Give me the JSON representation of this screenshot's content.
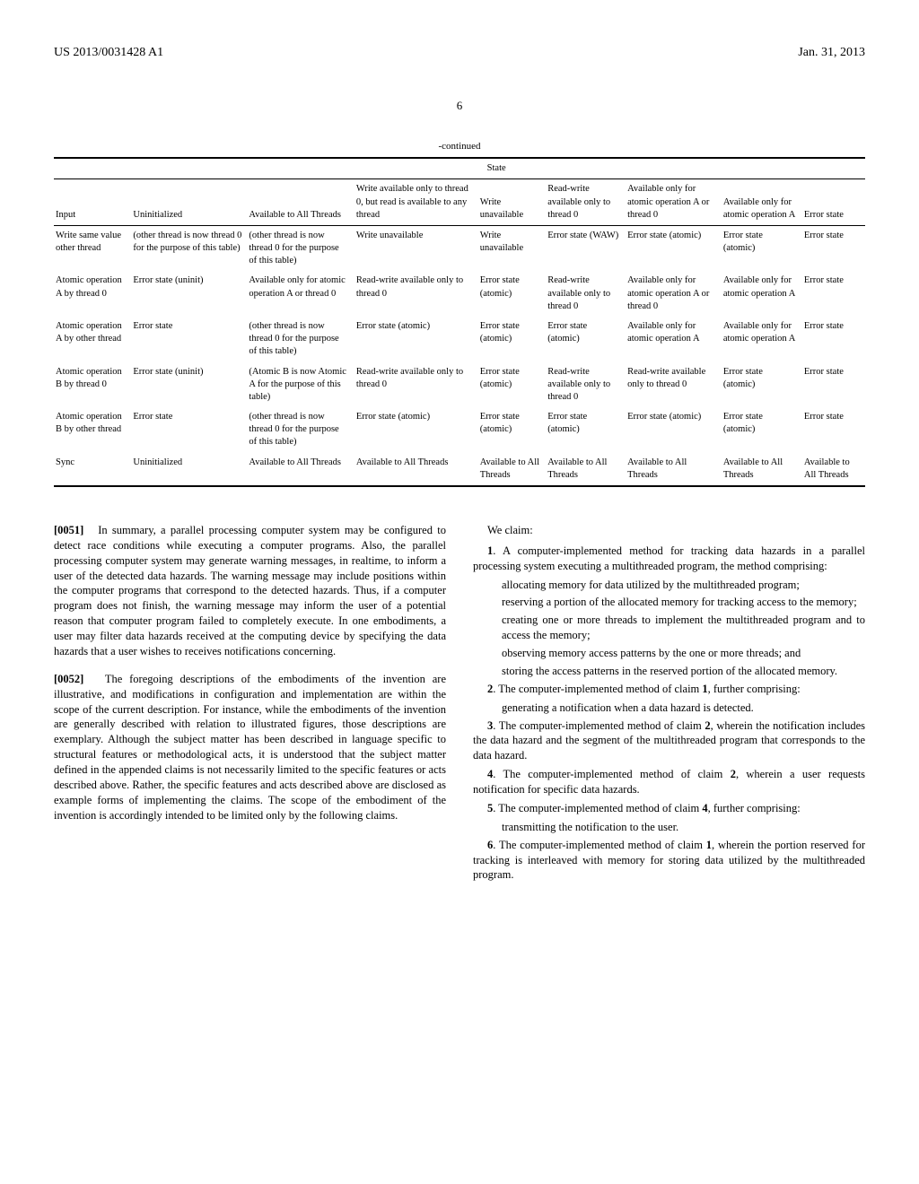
{
  "header": {
    "pub_number": "US 2013/0031428 A1",
    "pub_date": "Jan. 31, 2013"
  },
  "page_number": "6",
  "continued_label": "-continued",
  "table": {
    "group_header": "State",
    "row_headers_label": "Input",
    "columns": [
      "Uninitialized",
      "Available to All Threads",
      "Write available only to thread 0, but read is available to any thread",
      "Write unavailable",
      "Read-write available only to thread 0",
      "Available only for atomic operation A or thread 0",
      "Available only for atomic operation A",
      "Error state"
    ],
    "rows": [
      {
        "label": "Write same value other thread",
        "cells": [
          "(other thread is now thread 0 for the purpose of this table)",
          "(other thread is now thread 0 for the purpose of this table)",
          "Write unavailable",
          "Write unavailable",
          "Error state (WAW)",
          "Error state (atomic)",
          "Error state (atomic)",
          "Error state"
        ]
      },
      {
        "label": "Atomic operation A by thread 0",
        "cells": [
          "Error state (uninit)",
          "Available only for atomic operation A or thread 0",
          "Read-write available only to thread 0",
          "Error state (atomic)",
          "Read-write available only to thread 0",
          "Available only for atomic operation A or thread 0",
          "Available only for atomic operation A",
          "Error state"
        ]
      },
      {
        "label": "Atomic operation A by other thread",
        "cells": [
          "Error state",
          "(other thread is now thread 0 for the purpose of this table)",
          "Error state (atomic)",
          "Error state (atomic)",
          "Error state (atomic)",
          "Available only for atomic operation A",
          "Available only for atomic operation A",
          "Error state"
        ]
      },
      {
        "label": "Atomic operation B by thread 0",
        "cells": [
          "Error state (uninit)",
          "(Atomic B is now Atomic A for the purpose of this table)",
          "Read-write available only to thread 0",
          "Error state (atomic)",
          "Read-write available only to thread 0",
          "Read-write available only to thread 0",
          "Error state (atomic)",
          "Error state"
        ]
      },
      {
        "label": "Atomic operation B by other thread",
        "cells": [
          "Error state",
          "(other thread is now thread 0 for the purpose of this table)",
          "Error state (atomic)",
          "Error state (atomic)",
          "Error state (atomic)",
          "Error state (atomic)",
          "Error state (atomic)",
          "Error state"
        ]
      },
      {
        "label": "Sync",
        "cells": [
          "Uninitialized",
          "Available to All Threads",
          "Available to All Threads",
          "Available to All Threads",
          "Available to All Threads",
          "Available to All Threads",
          "Available to All Threads",
          "Available to All Threads"
        ]
      }
    ]
  },
  "paragraphs": {
    "p0051_num": "[0051]",
    "p0051": "In summary, a parallel processing computer system may be configured to detect race conditions while executing a computer programs. Also, the parallel processing computer system may generate warning messages, in realtime, to inform a user of the detected data hazards. The warning message may include positions within the computer programs that correspond to the detected hazards. Thus, if a computer program does not finish, the warning message may inform the user of a potential reason that computer program failed to completely execute. In one embodiments, a user may filter data hazards received at the computing device by specifying the data hazards that a user wishes to receives notifications concerning.",
    "p0052_num": "[0052]",
    "p0052": "The foregoing descriptions of the embodiments of the invention are illustrative, and modifications in configuration and implementation are within the scope of the current description. For instance, while the embodiments of the invention are generally described with relation to illustrated figures, those descriptions are exemplary. Although the subject matter has been described in language specific to structural features or methodological acts, it is understood that the subject matter defined in the appended claims is not necessarily limited to the specific features or acts described above. Rather, the specific features and acts described above are disclosed as example forms of implementing the claims. The scope of the embodiment of the invention is accordingly intended to be limited only by the following claims."
  },
  "claims": {
    "we_claim": "We claim:",
    "c1_lead": "1. A computer-implemented method for tracking data hazards in a parallel processing system executing a multithreaded program, the method comprising:",
    "c1_b1": "allocating memory for data utilized by the multithreaded program;",
    "c1_b2": "reserving a portion of the allocated memory for tracking access to the memory;",
    "c1_b3": "creating one or more threads to implement the multithreaded program and to access the memory;",
    "c1_b4": "observing memory access patterns by the one or more threads; and",
    "c1_b5": "storing the access patterns in the reserved portion of the allocated memory.",
    "c2_lead": "2. The computer-implemented method of claim 1, further comprising:",
    "c2_b1": "generating a notification when a data hazard is detected.",
    "c3": "3. The computer-implemented method of claim 2, wherein the notification includes the data hazard and the segment of the multithreaded program that corresponds to the data hazard.",
    "c4": "4. The computer-implemented method of claim 2, wherein a user requests notification for specific data hazards.",
    "c5_lead": "5. The computer-implemented method of claim 4, further comprising:",
    "c5_b1": "transmitting the notification to the user.",
    "c6": "6. The computer-implemented method of claim 1, wherein the portion reserved for tracking is interleaved with memory for storing data utilized by the multithreaded program."
  }
}
